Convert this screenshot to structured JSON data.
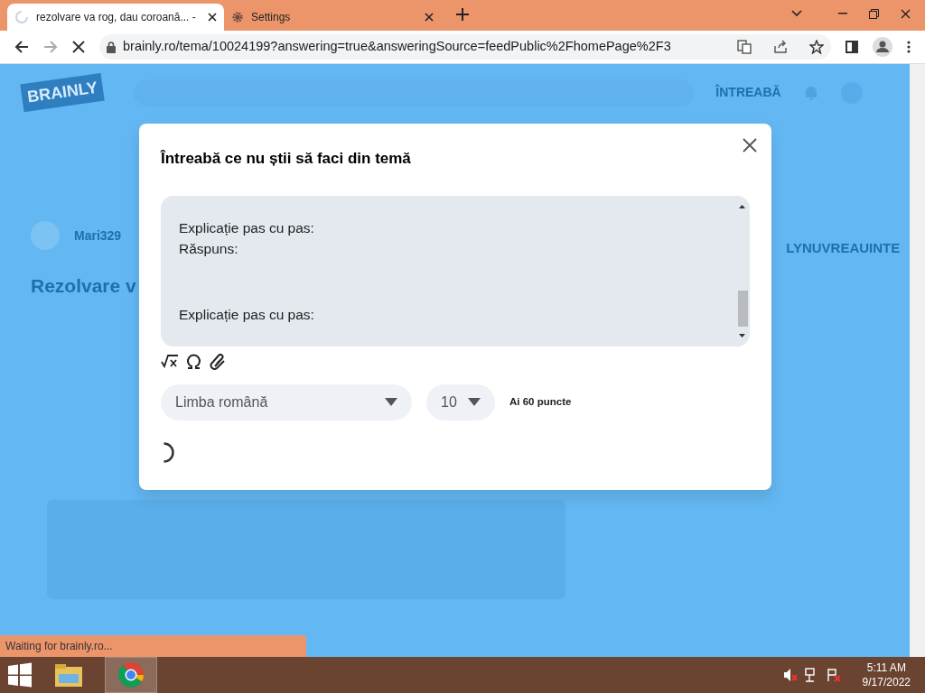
{
  "browser": {
    "tabs": [
      {
        "title": "rezolvare va rog, dau coroană... -",
        "selected": true,
        "loading": true
      },
      {
        "title": "Settings",
        "selected": false,
        "loading": false
      }
    ],
    "url": "brainly.ro/tema/10024199?answering=true&answeringSource=feedPublic%2FhomePage%2F3",
    "page_loading": true,
    "status": "Waiting for brainly.ro..."
  },
  "page": {
    "logo": "BRAINLY",
    "ask_link": "ÎNTREABĂ",
    "user": "Mari329",
    "title": "Rezolvare v",
    "side_text": "LYNUVREAUINTE"
  },
  "dialog": {
    "title": "Întreabă ce nu știi să faci din temă",
    "answer_paragraphs": [
      [
        "Explicație pas cu pas:",
        "Răspuns:"
      ],
      [
        "Explicație pas cu pas:"
      ]
    ],
    "subject": "Limba română",
    "points": "10",
    "points_note": "Ai 60 puncte",
    "submitting": true
  },
  "taskbar": {
    "time": "5:11 AM",
    "date": "9/17/2022"
  }
}
